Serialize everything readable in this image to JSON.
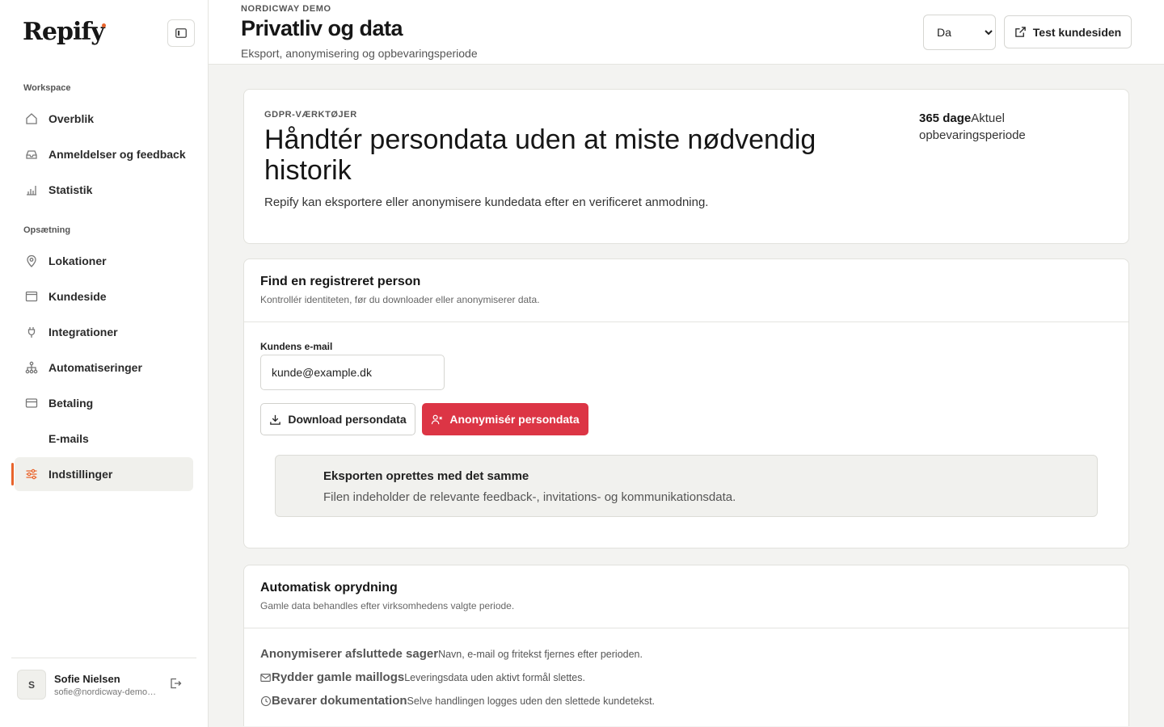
{
  "app": {
    "logo": "Repify"
  },
  "sidebar": {
    "workspace_label": "Workspace",
    "setup_label": "Opsætning",
    "workspace_items": [
      {
        "label": "Overblik",
        "icon": "home-icon"
      },
      {
        "label": "Anmeldelser og feedback",
        "icon": "inbox-icon"
      },
      {
        "label": "Statistik",
        "icon": "bar-chart-icon"
      }
    ],
    "setup_items": [
      {
        "label": "Lokationer",
        "icon": "location-pin-icon"
      },
      {
        "label": "Kundeside",
        "icon": "browser-window-icon"
      },
      {
        "label": "Integrationer",
        "icon": "plug-icon"
      },
      {
        "label": "Automatiseringer",
        "icon": "workflow-icon"
      },
      {
        "label": "Betaling",
        "icon": "credit-card-icon"
      },
      {
        "label": "E-mails",
        "icon": ""
      },
      {
        "label": "Indstillinger",
        "icon": "sliders-icon",
        "active": true
      }
    ],
    "user": {
      "initial": "S",
      "name": "Sofie Nielsen",
      "email": "sofie@nordicway-demo.dk"
    }
  },
  "header": {
    "eyebrow": "NORDICWAY DEMO",
    "title": "Privatliv og data",
    "subtitle": "Eksport, anonymisering og opbevaringsperiode",
    "language": "Da",
    "test_button": "Test kundesiden"
  },
  "hero": {
    "eyebrow": "GDPR-VÆRKTØJER",
    "title": "Håndtér persondata uden at miste nødvendig historik",
    "description": "Repify kan eksportere eller anonymisere kundedata efter en verificeret anmodning.",
    "stat_value": "365 dage",
    "stat_label": "Aktuel opbevaringsperiode"
  },
  "find": {
    "title": "Find en registreret person",
    "subtitle": "Kontrollér identiteten, før du downloader eller anonymiserer data.",
    "email_label": "Kundens e-mail",
    "email_value": "kunde@example.dk",
    "download_button": "Download persondata",
    "anonymize_button": "Anonymisér persondata",
    "notice_title": "Eksporten oprettes med det samme",
    "notice_text": "Filen indeholder de relevante feedback-, invitations- og kommunikationsdata."
  },
  "cleanup": {
    "title": "Automatisk oprydning",
    "subtitle": "Gamle data behandles efter virksomhedens valgte periode.",
    "rules": [
      {
        "title": "Anonymiserer afsluttede sager",
        "text": "Navn, e-mail og fritekst fjernes efter perioden."
      },
      {
        "title": "Rydder gamle maillogs",
        "text": "Leveringsdata uden aktivt formål slettes."
      },
      {
        "title": "Bevarer dokumentation",
        "text": "Selve handlingen logges uden den slettede kundetekst."
      }
    ]
  },
  "colors": {
    "accent": "#e8642c",
    "danger": "#dc3545"
  }
}
